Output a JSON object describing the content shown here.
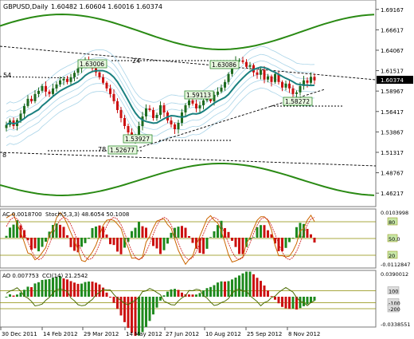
{
  "header": {
    "symbol": "GBPUSD,Daily",
    "ohlc": "1.60482 1.60604 1.60016 1.60374"
  },
  "ac_label": "AC 0.0018700",
  "stoch_label": "Stoch(5,3,3) 48.6054 50.1008",
  "ao_label": "AO 0.007753",
  "cci_label": "CCI(14) 21.2542",
  "colors": {
    "background": "#ffffff",
    "panel_bg": "#ffffff",
    "axis_bg": "#ffffff",
    "bull_candle": "#1f6b1f",
    "bear_candle": "#cc1111",
    "ma_teal": "#1a8080",
    "envelope_green": "#2a8a14",
    "band_lightblue": "#a9d4e8",
    "trendline": "#000000",
    "osc_olive": "#8b8b00",
    "stoch_orange": "#cc6600",
    "label_box": "#e8f7e0",
    "label_border": "#2e8b2e",
    "price_box": "#000000"
  },
  "chart_data": [
    {
      "type": "candlestick",
      "title": "GBPUSD,Daily",
      "ylim": [
        1.4474,
        1.7014
      ],
      "y_ticks": [
        "1.69167",
        "1.66617",
        "1.64067",
        "1.61517",
        "1.58967",
        "1.56417",
        "1.53867",
        "1.51317",
        "1.48767",
        "1.46217"
      ],
      "current_price": "1.60374",
      "x_ticks": [
        "30 Dec 2011",
        "14 Feb 2012",
        "29 Mar 2012",
        "14 May 2012",
        "27 Jun 2012",
        "10 Aug 2012",
        "25 Sep 2012",
        "8 Nov 2012"
      ],
      "price_labels": [
        {
          "text": "1.63006",
          "price": 1.63006
        },
        {
          "text": "1.63086",
          "price": 1.63086
        },
        {
          "text": "1.59113",
          "price": 1.59113
        },
        {
          "text": "1.58272",
          "price": 1.58272
        },
        {
          "text": "1.53927",
          "price": 1.53927
        },
        {
          "text": "1.52677",
          "price": 1.52677
        }
      ],
      "annotations": [
        "54",
        "24",
        "78",
        "8"
      ],
      "series": [
        {
          "name": "closes",
          "values": [
            1.5475,
            1.553,
            1.546,
            1.5535,
            1.5615,
            1.571,
            1.58,
            1.577,
            1.586,
            1.59,
            1.596,
            1.589,
            1.586,
            1.593,
            1.598,
            1.603,
            1.605,
            1.601,
            1.607,
            1.6125,
            1.618,
            1.624,
            1.629,
            1.623,
            1.618,
            1.613,
            1.607,
            1.6,
            1.593,
            1.586,
            1.577,
            1.566,
            1.556,
            1.546,
            1.538,
            1.529,
            1.533,
            1.546,
            1.558,
            1.568,
            1.566,
            1.556,
            1.56,
            1.572,
            1.563,
            1.553,
            1.548,
            1.542,
            1.55,
            1.563,
            1.572,
            1.578,
            1.574,
            1.568,
            1.572,
            1.578,
            1.58,
            1.577,
            1.585,
            1.589,
            1.594,
            1.601,
            1.611,
            1.622,
            1.628,
            1.628,
            1.626,
            1.62,
            1.622,
            1.613,
            1.61,
            1.616,
            1.604,
            1.608,
            1.601,
            1.611,
            1.601,
            1.594,
            1.599,
            1.593,
            1.586,
            1.588,
            1.596,
            1.603,
            1.6,
            1.6075,
            1.603
          ]
        }
      ]
    },
    {
      "type": "bar",
      "title": "AC 0.0018700 Stoch(5,3,3) 48.6054 50.1008",
      "y_ticks": [
        "0.0103998",
        "80",
        "50.0",
        "20",
        "-0.0112847"
      ],
      "levels": [
        80,
        50,
        20
      ],
      "ylim": [
        -0.0112847,
        0.0103998
      ]
    },
    {
      "type": "bar",
      "title": "AO 0.007753 CCI(14) 21.2542",
      "y_ticks": [
        "0.0390012",
        "100",
        "-100",
        "-200",
        "-0.0338551"
      ],
      "levels": [
        100,
        -100,
        -200
      ],
      "ylim": [
        -0.0338551,
        0.0390012
      ]
    }
  ]
}
